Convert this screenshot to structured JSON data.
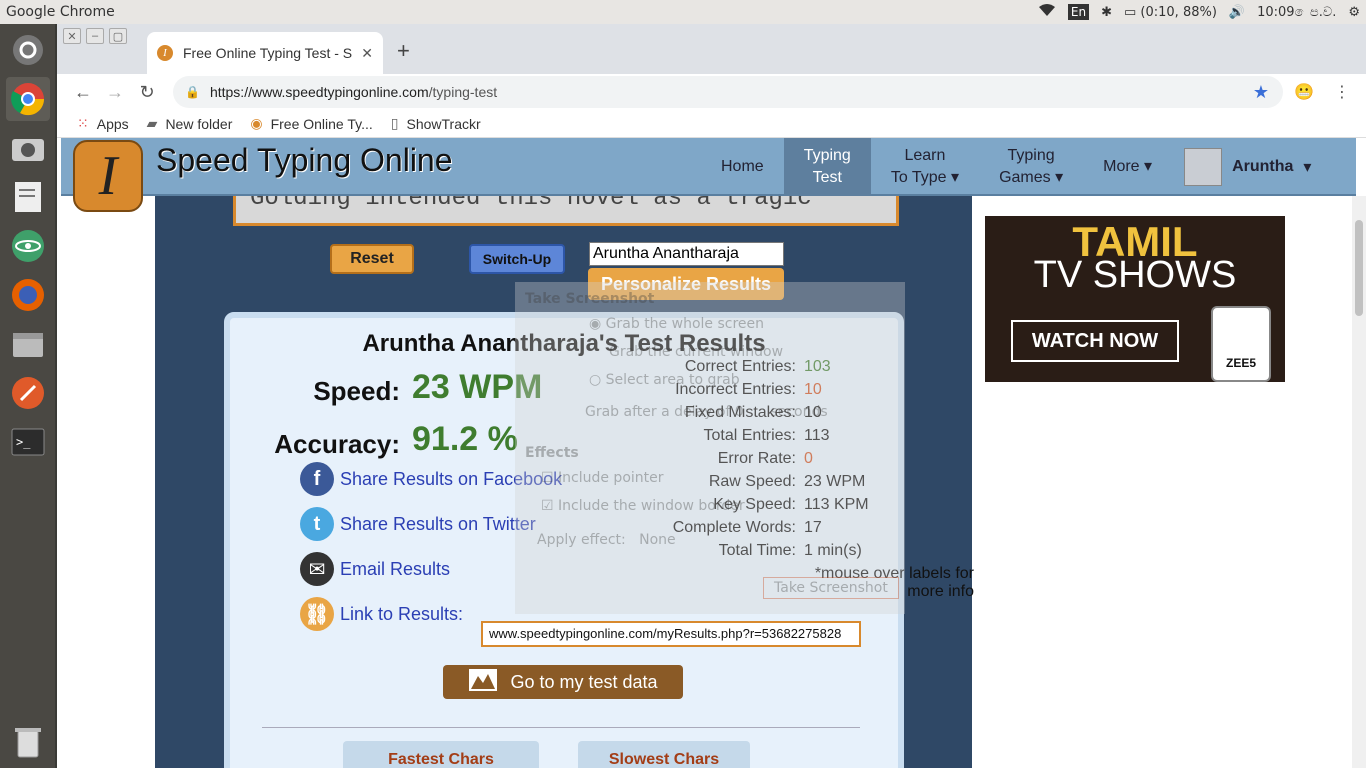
{
  "os": {
    "app_title": "Google Chrome",
    "lang": "En",
    "battery": "(0:10, 88%)",
    "time": "10:09 ෙප.ව.",
    "launcher_icons": [
      "ubuntu-dash-icon",
      "chrome-icon",
      "screenshot-icon",
      "text-editor-icon",
      "atom-icon",
      "firefox-icon",
      "files-icon",
      "ruby-icon",
      "terminal-icon",
      "trash-icon"
    ]
  },
  "browser": {
    "tab_title": "Free Online Typing Test - S",
    "tab_favicon": "I",
    "url_host": "https://www.speedtypingonline.com",
    "url_path": "/typing-test",
    "bookmarks": [
      "Apps",
      "New folder",
      "Free Online Ty...",
      "ShowTrackr"
    ]
  },
  "site": {
    "logo_letter": "I",
    "name": "Speed Typing Online",
    "nav": {
      "home": "Home",
      "typing_test_1": "Typing",
      "typing_test_2": "Test",
      "learn_1": "Learn",
      "learn_2": "To Type",
      "games_1": "Typing",
      "games_2": "Games",
      "more": "More",
      "user": "Aruntha",
      "caret": "▾"
    }
  },
  "test": {
    "text_preview": "Golding intended this novel as a tragic",
    "reset_label": "Reset",
    "switch_label": "Switch-Up",
    "name_value": "Aruntha Anantharaja",
    "personalize_label": "Personalize Results"
  },
  "results": {
    "title": "Aruntha Anantharaja's Test Results",
    "speed_label": "Speed:",
    "speed_value": "23 WPM",
    "accuracy_label": "Accuracy:",
    "accuracy_value": "91.2 %",
    "share_facebook": "Share Results on Facebook",
    "share_twitter": "Share Results on Twitter",
    "email": "Email Results",
    "link_label": "Link to Results:",
    "link_value": "www.speedtypingonline.com/myResults.php?r=53682275828",
    "data_button": "Go to my test data",
    "fastest": "Fastest Chars",
    "slowest": "Slowest Chars",
    "stats": [
      {
        "label": "Correct Entries:",
        "value": "103",
        "color": "#3f7d2f"
      },
      {
        "label": "Incorrect Entries:",
        "value": "10",
        "color": "#d0501e"
      },
      {
        "label": "Fixed Mistakes:",
        "value": "10",
        "color": "#111111"
      },
      {
        "label": "Total Entries:",
        "value": "113",
        "color": "#111111"
      },
      {
        "label": "Error Rate:",
        "value": "0",
        "color": "#d0501e"
      },
      {
        "label": "Raw Speed:",
        "value": "23 WPM",
        "color": "#111111"
      },
      {
        "label": "Key Speed:",
        "value": "113 KPM",
        "color": "#111111"
      },
      {
        "label": "Complete Words:",
        "value": "17",
        "color": "#111111"
      },
      {
        "label": "Total Time:",
        "value": "1 min(s)",
        "color": "#111111"
      }
    ],
    "note_1": "*mouse over labels for",
    "note_2": "more info"
  },
  "screenshot_dialog": {
    "title": "Take Screenshot",
    "opt_whole": "Grab the whole screen",
    "opt_window": "Grab the current window",
    "opt_area": "Select area to grab",
    "delay_prefix": "Grab after a delay of",
    "delay_value": "0",
    "delay_suffix": "seconds",
    "effects": "Effects",
    "pointer": "Include pointer",
    "border": "Include the window border",
    "apply": "Apply effect:",
    "apply_value": "None",
    "take_button": "Take Screenshot"
  },
  "ad": {
    "line1": "TAMIL",
    "line2": "TV SHOWS",
    "cta": "WATCH NOW",
    "brand": "ZEE5"
  }
}
